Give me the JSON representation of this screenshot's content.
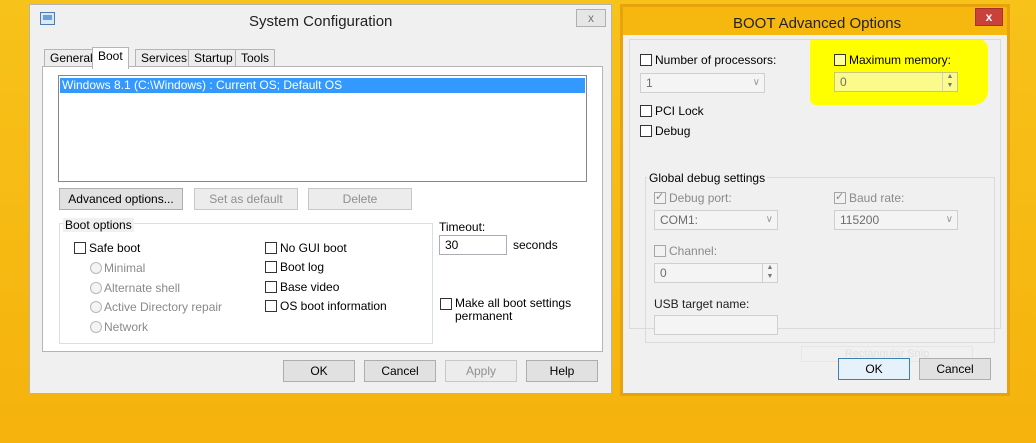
{
  "sysconfig": {
    "title": "System Configuration",
    "close": "x",
    "tabs": [
      {
        "label": "General"
      },
      {
        "label": "Boot"
      },
      {
        "label": "Services"
      },
      {
        "label": "Startup"
      },
      {
        "label": "Tools"
      }
    ],
    "os_entry": "Windows 8.1 (C:\\Windows) : Current OS; Default OS",
    "advanced_btn": "Advanced options...",
    "default_btn": "Set as default",
    "delete_btn": "Delete",
    "boot_options": {
      "heading": "Boot options",
      "safe_boot": "Safe boot",
      "minimal": "Minimal",
      "alt_shell": "Alternate shell",
      "ad_repair": "Active Directory repair",
      "network": "Network",
      "no_gui": "No GUI boot",
      "boot_log": "Boot log",
      "base_video": "Base video",
      "os_info": "OS boot information"
    },
    "timeout": {
      "label": "Timeout:",
      "value": "30",
      "unit": "seconds"
    },
    "make_permanent": "Make all boot settings permanent",
    "ok": "OK",
    "cancel": "Cancel",
    "apply": "Apply",
    "help": "Help"
  },
  "advanced": {
    "title": "BOOT Advanced Options",
    "close": "x",
    "num_proc": {
      "label": "Number of processors:",
      "value": "1"
    },
    "max_mem": {
      "label": "Maximum memory:",
      "value": "0"
    },
    "pci_lock": "PCI Lock",
    "debug": "Debug",
    "global_debug": {
      "heading": "Global debug settings",
      "debug_port": {
        "label": "Debug port:",
        "value": "COM1:"
      },
      "baud_rate": {
        "label": "Baud rate:",
        "value": "115200"
      },
      "channel": {
        "label": "Channel:",
        "value": "0"
      },
      "usb_target": {
        "label": "USB target name:",
        "value": ""
      }
    },
    "ghost_label": "Rectangular Snip",
    "ok": "OK",
    "cancel": "Cancel"
  },
  "colors": {
    "desktop": "#f6b80f",
    "highlight": "#ffff00",
    "selection": "#3399ff",
    "close_red": "#c9413a"
  }
}
